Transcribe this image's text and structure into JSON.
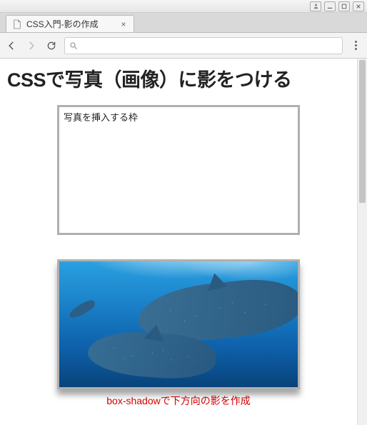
{
  "window": {
    "user_icon": "user-icon",
    "minimize": "–",
    "maximize": "□",
    "close": "×"
  },
  "browser": {
    "tab": {
      "title": "CSS入門-影の作成",
      "close": "×"
    },
    "nav": {
      "back": "back",
      "forward": "forward",
      "reload": "reload"
    },
    "omnibox": {
      "value": "",
      "placeholder": ""
    }
  },
  "page": {
    "heading": "CSSで写真（画像）に影をつける",
    "frame_label": "写真を挿入する枠",
    "photo_alt": "whale-shark-aquarium",
    "caption": "box-shadowで下方向の影を作成"
  }
}
